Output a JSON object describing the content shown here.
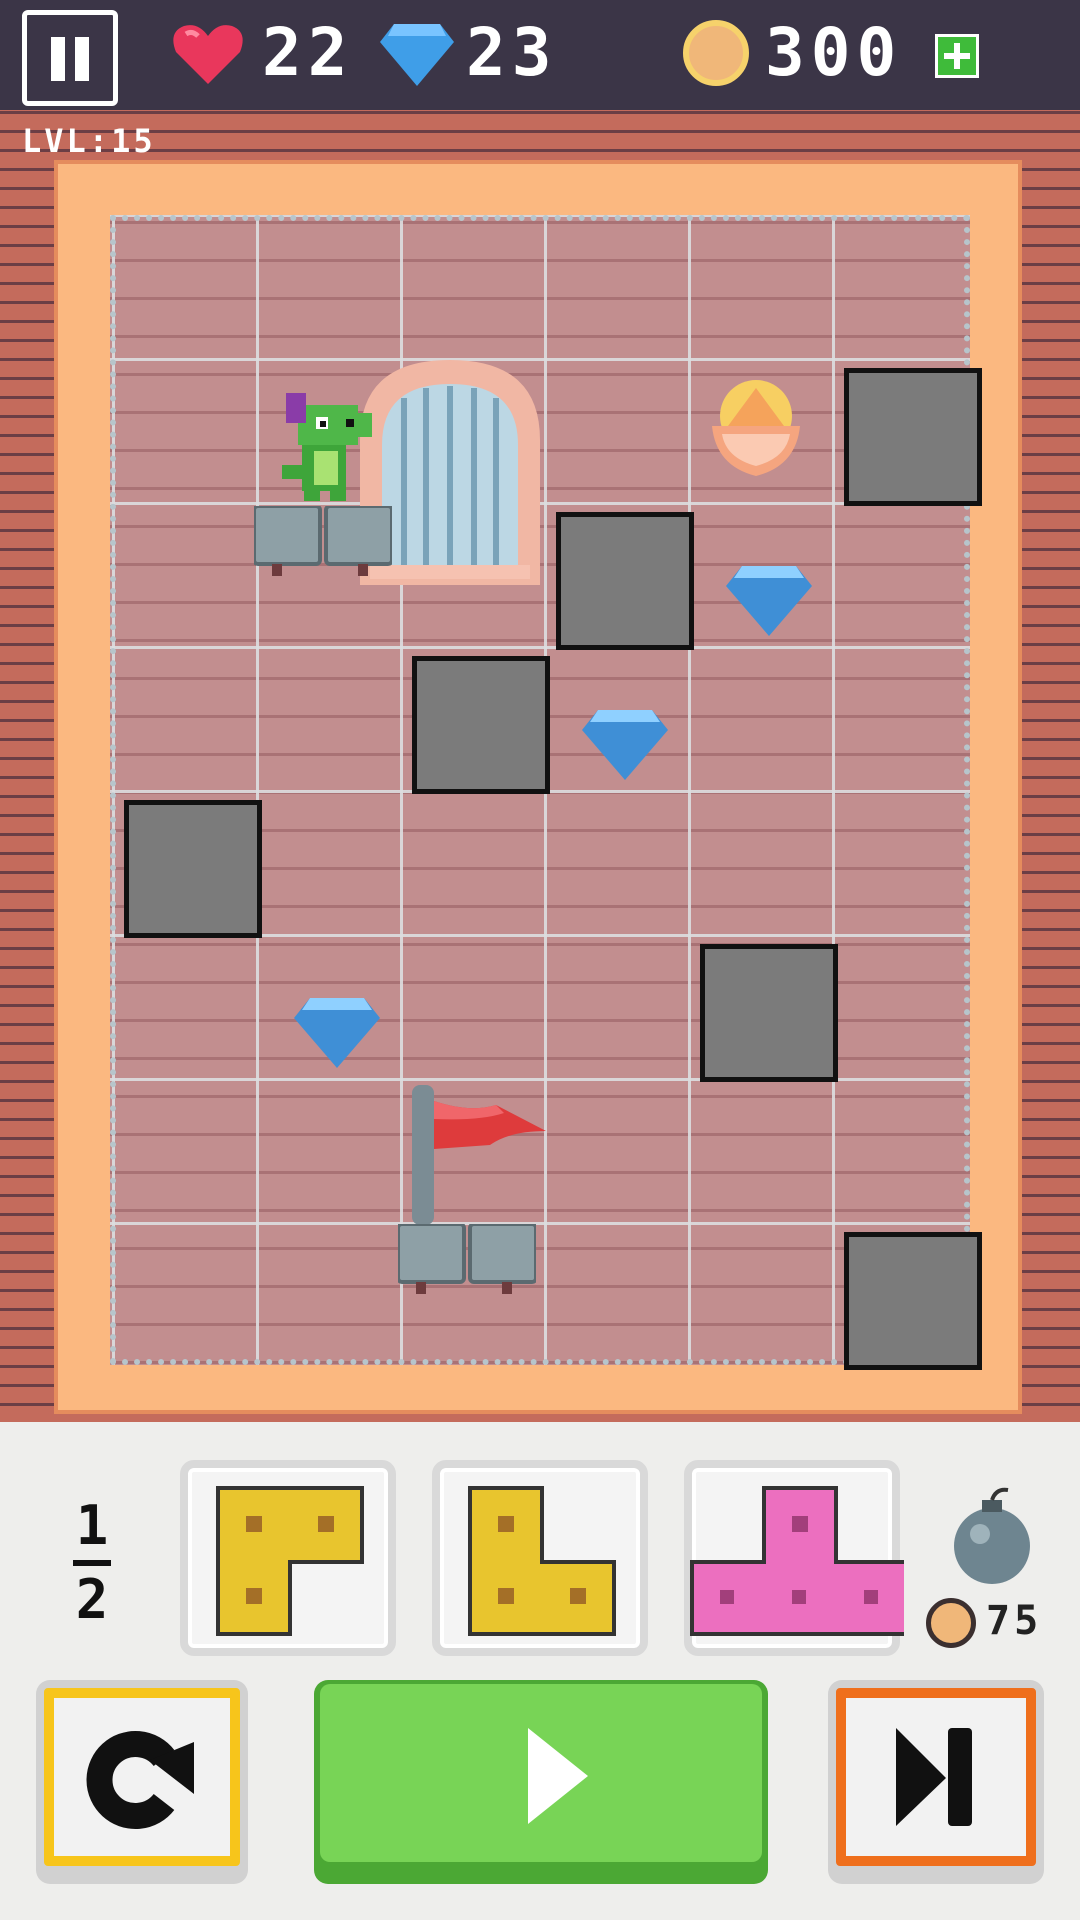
{
  "hud": {
    "lives": "22",
    "gems": "23",
    "coins": "300",
    "level": "LVL:15"
  },
  "board": {
    "columns": 6,
    "rows": 8,
    "blocks": [
      [
        5,
        1
      ],
      [
        3,
        2
      ],
      [
        2,
        3
      ],
      [
        0,
        4
      ],
      [
        4,
        5
      ],
      [
        5,
        7
      ]
    ],
    "gems": [
      [
        4,
        2
      ],
      [
        3,
        3
      ],
      [
        1,
        5
      ]
    ],
    "player": [
      1,
      1
    ],
    "goal": [
      2,
      6
    ],
    "pot": [
      4,
      1
    ]
  },
  "pieces": {
    "page_current": "1",
    "page_total": "2",
    "items": [
      {
        "shape": "corner",
        "color": "#e8c52e"
      },
      {
        "shape": "L",
        "color": "#e8c52e"
      },
      {
        "shape": "T",
        "color": "#ec6fbf"
      }
    ],
    "bomb_cost": "75"
  },
  "colors": {
    "yellow_piece": "#e8c52e",
    "pink_piece": "#ec6fbf",
    "play_green": "#78d456",
    "reset_border": "#f7c51b",
    "skip_border": "#ef6f1c"
  }
}
